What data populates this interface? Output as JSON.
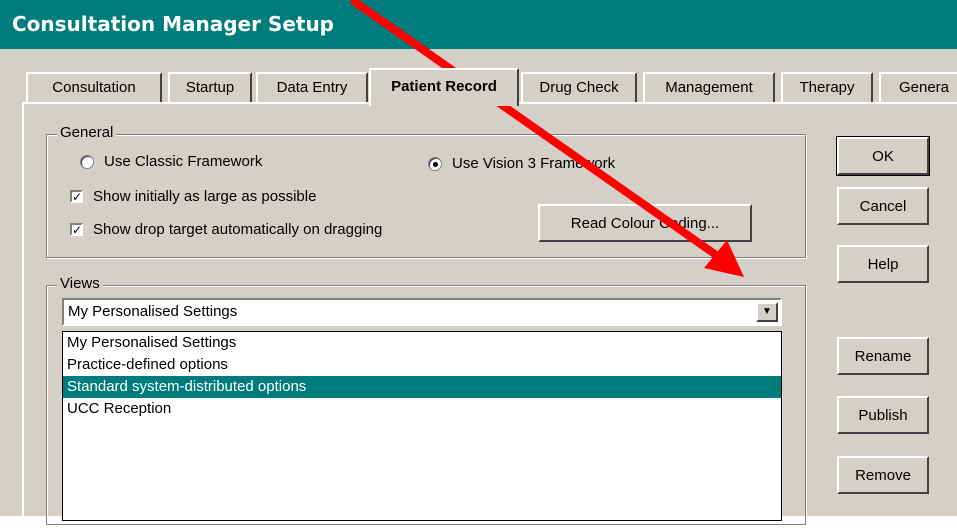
{
  "window": {
    "title": "Consultation Manager Setup"
  },
  "tabs": [
    {
      "label": "Consultation"
    },
    {
      "label": "Startup"
    },
    {
      "label": "Data Entry"
    },
    {
      "label": "Patient Record",
      "active": true
    },
    {
      "label": "Drug Check"
    },
    {
      "label": "Management"
    },
    {
      "label": "Therapy"
    },
    {
      "label": "Genera"
    }
  ],
  "general": {
    "legend": "General",
    "radio_classic": {
      "label": "Use Classic Framework",
      "checked": false
    },
    "radio_vision3": {
      "label": "Use Vision 3 Framework",
      "checked": true
    },
    "check_large": {
      "label": "Show initially as large as possible",
      "checked": true
    },
    "check_drop": {
      "label": "Show drop target automatically on dragging",
      "checked": true
    },
    "read_colour_button": "Read Colour Coding..."
  },
  "views": {
    "legend": "Views",
    "selected_value": "My Personalised Settings",
    "options": [
      {
        "label": "My Personalised Settings",
        "selected": false
      },
      {
        "label": "Practice-defined options",
        "selected": false
      },
      {
        "label": "Standard system-distributed options",
        "selected": true
      },
      {
        "label": "UCC Reception",
        "selected": false
      }
    ]
  },
  "buttons": {
    "ok": "OK",
    "cancel": "Cancel",
    "help": "Help",
    "rename": "Rename",
    "publish": "Publish",
    "remove": "Remove"
  },
  "colors": {
    "titlebar": "#007c7c",
    "selection": "#007c7c",
    "annotation_arrow": "#ff0000",
    "face": "#d4d0c8"
  }
}
